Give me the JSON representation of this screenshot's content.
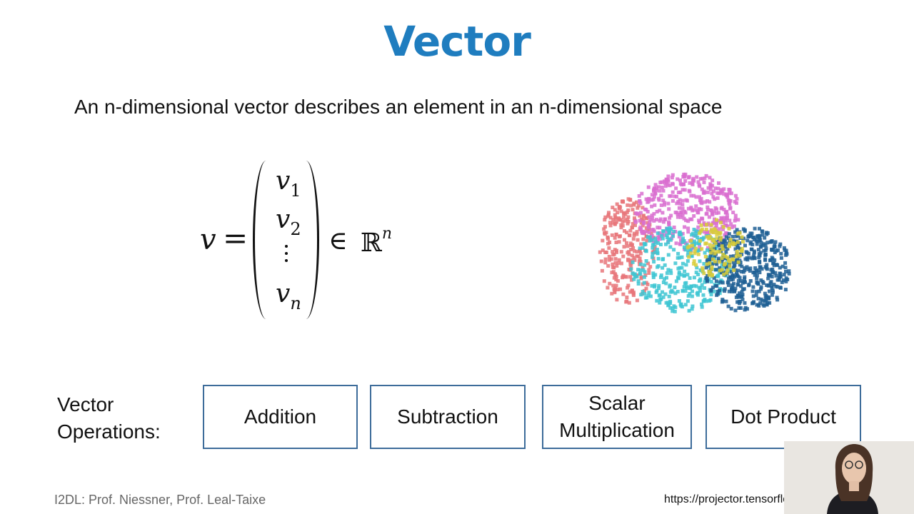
{
  "slide": {
    "title": "Vector",
    "subtitle": "An n-dimensional vector describes an element in an n-dimensional space"
  },
  "formula": {
    "lhs": "v",
    "equals": "=",
    "entries": [
      {
        "base": "v",
        "index": "1"
      },
      {
        "base": "v",
        "index": "2"
      },
      {
        "base": "v",
        "index": "n"
      }
    ],
    "element_of": "∈",
    "space": "ℝ",
    "space_power": "n"
  },
  "scatter": {
    "clusters": [
      {
        "color": "#e8767a"
      },
      {
        "color": "#d96fd0"
      },
      {
        "color": "#3ec6d2"
      },
      {
        "color": "#1f5f94"
      },
      {
        "color": "#d8cc3a"
      }
    ]
  },
  "operations": {
    "label_line1": "Vector",
    "label_line2": "Operations:",
    "items": [
      {
        "label": "Addition"
      },
      {
        "label_line1": "Subtraction"
      },
      {
        "label_line1": "Scalar",
        "label_line2": "Multiplication"
      },
      {
        "label": "Dot Product"
      }
    ]
  },
  "footer": {
    "credit": "I2DL: Prof. Niessner, Prof. Leal-Taixe",
    "source_url": "https://projector.tensorflow.org"
  },
  "colors": {
    "title": "#1f7dbf",
    "box_border": "#3d6c9a"
  }
}
